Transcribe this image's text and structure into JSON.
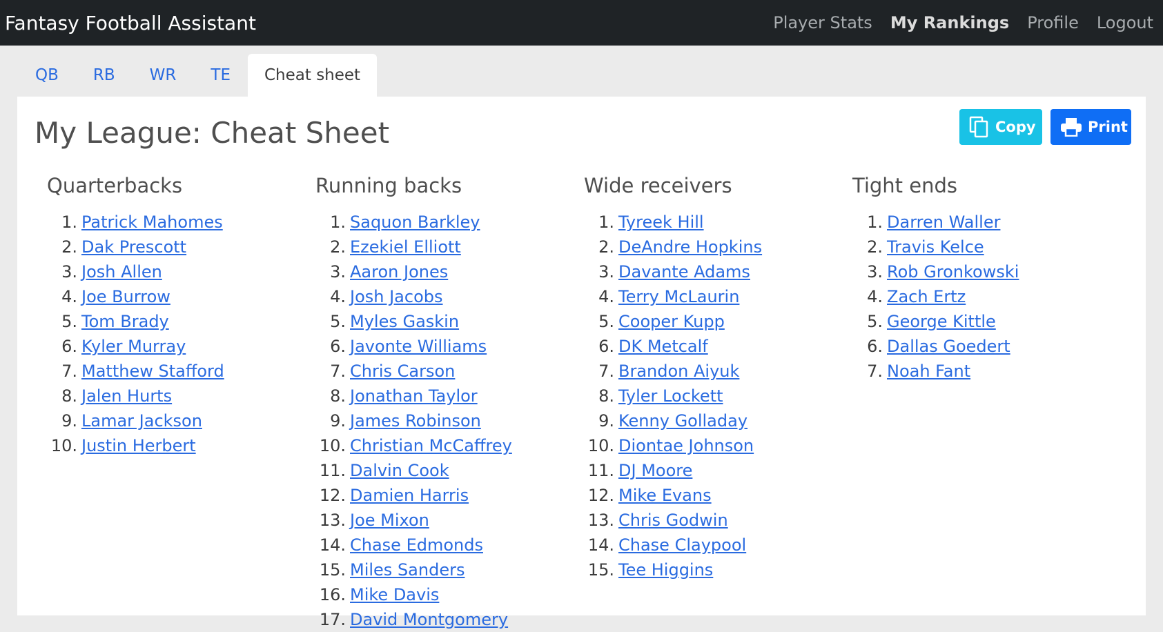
{
  "app": {
    "title": "Fantasy Football Assistant",
    "nav": [
      {
        "label": "Player Stats",
        "active": false
      },
      {
        "label": "My Rankings",
        "active": true
      },
      {
        "label": "Profile",
        "active": false
      },
      {
        "label": "Logout",
        "active": false
      }
    ]
  },
  "tabs": [
    {
      "label": "QB",
      "active": false
    },
    {
      "label": "RB",
      "active": false
    },
    {
      "label": "WR",
      "active": false
    },
    {
      "label": "TE",
      "active": false
    },
    {
      "label": "Cheat sheet",
      "active": true
    }
  ],
  "page": {
    "title": "My League: Cheat Sheet",
    "copy_label": "Copy",
    "print_label": "Print"
  },
  "columns": [
    {
      "heading": "Quarterbacks",
      "players": [
        "Patrick Mahomes",
        "Dak Prescott",
        "Josh Allen",
        "Joe Burrow",
        "Tom Brady",
        "Kyler Murray",
        "Matthew Stafford",
        "Jalen Hurts",
        "Lamar Jackson",
        "Justin Herbert"
      ]
    },
    {
      "heading": "Running backs",
      "players": [
        "Saquon Barkley",
        "Ezekiel Elliott",
        "Aaron Jones",
        "Josh Jacobs",
        "Myles Gaskin",
        "Javonte Williams",
        "Chris Carson",
        "Jonathan Taylor",
        "James Robinson",
        "Christian McCaffrey",
        "Dalvin Cook",
        "Damien Harris",
        "Joe Mixon",
        "Chase Edmonds",
        "Miles Sanders",
        "Mike Davis",
        "David Montgomery"
      ]
    },
    {
      "heading": "Wide receivers",
      "players": [
        "Tyreek Hill",
        "DeAndre Hopkins",
        "Davante Adams",
        "Terry McLaurin",
        "Cooper Kupp",
        "DK Metcalf",
        "Brandon Aiyuk",
        "Tyler Lockett",
        "Kenny Golladay",
        "Diontae Johnson",
        "DJ Moore",
        "Mike Evans",
        "Chris Godwin",
        "Chase Claypool",
        "Tee Higgins"
      ]
    },
    {
      "heading": "Tight ends",
      "players": [
        "Darren Waller",
        "Travis Kelce",
        "Rob Gronkowski",
        "Zach Ertz",
        "George Kittle",
        "Dallas Goedert",
        "Noah Fant"
      ]
    }
  ]
}
